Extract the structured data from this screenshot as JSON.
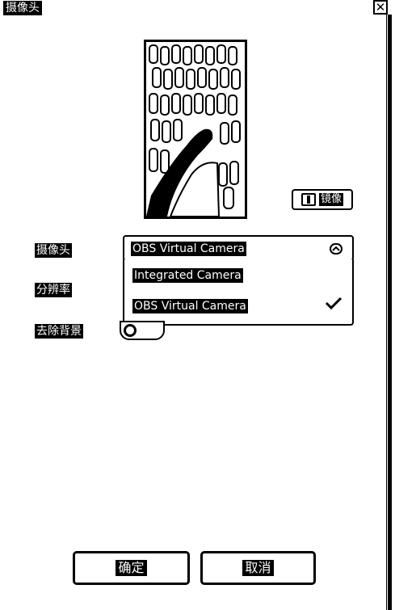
{
  "window": {
    "title": "摄像头",
    "close_glyph": "✕"
  },
  "preview": {
    "mirror_label": "镜像"
  },
  "form": {
    "camera_label": "摄像头",
    "resolution_label": "分辨率",
    "remove_bg_label": "去除背景",
    "camera_select": {
      "selected": "OBS Virtual Camera",
      "options": [
        "Integrated Camera",
        "OBS Virtual Camera"
      ]
    },
    "remove_bg_enabled": false
  },
  "footer": {
    "confirm_label": "确定",
    "cancel_label": "取消"
  }
}
